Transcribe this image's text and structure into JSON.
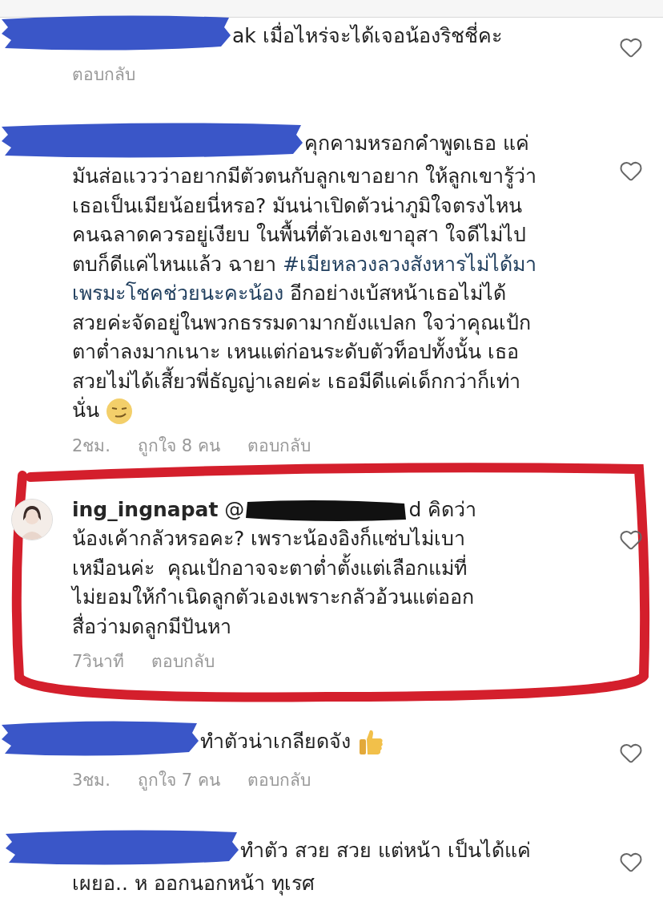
{
  "comments": [
    {
      "segments": [
        {
          "kind": "scribble"
        },
        {
          "kind": "text",
          "text": "ak เมื่อไหร่จะได้เจอน้องริชชี่คะ"
        }
      ],
      "meta": [
        "ตอบกลับ"
      ]
    },
    {
      "segments": [
        {
          "kind": "scribble"
        },
        {
          "kind": "text",
          "text": "คุกคามหรอกคำพูดเธอ แค่\nมันส่อแววว่าอยากมีตัวตนกับลูกเขาอยาก ให้ลูกเขารู้ว่า\nเธอเป็นเมียน้อยนี่หรอ? มันน่าเปิดตัวน่าภูมิใจตรงไหน\nคนฉลาดควรอยู่เงียบ ในพื้นที่ตัวเองเขาอุสา ใจดีไม่ไป\nตบก็ดีแค่ไหนแล้ว ฉายา "
        },
        {
          "kind": "hashtag",
          "text": "#เมียหลวงลวงสังหารไม่ได้มา"
        },
        {
          "kind": "line_break"
        },
        {
          "kind": "hashtag",
          "text": "เพรมะโชคช่วยนะคะน้อง"
        },
        {
          "kind": "text",
          "text": " อีกอย่างเบ้สหน้าเธอไม่ได้\nสวยค่ะจัดอยู่ในพวกธรรมดามากยังแปลก ใจว่าคุณเป้ก\nตาต่ำลงมากเนาะ เหนแต่ก่อนระดับตัวท็อปทั้งนั้น เธอ\nสวยไม่ได้เสี้ยวพี่ธัญญ่าเลยค่ะ เธอมีดีแค่เด็กกว่าก็เท่า\nนั่น "
        },
        {
          "kind": "smirk_emoji"
        }
      ],
      "meta": [
        "2ชม.",
        "ถูกใจ 8 คน",
        "ตอบกลับ"
      ]
    },
    {
      "avatar": {
        "kind": "picture"
      },
      "highlighted": true,
      "segments": [
        {
          "kind": "username",
          "text": "ing_ingnapat"
        },
        {
          "kind": "text",
          "text": " @"
        },
        {
          "kind": "blackout"
        },
        {
          "kind": "text",
          "text": "d คิดว่า\nน้องเค้ากลัวหรอคะ? เพราะน้องอิงก็แซ่บไม่เบา\nเหมือนค่ะ  คุณเป้กอาจจะตาต่ำตั้งแต่เลือกแม่ที่\nไม่ยอมให้กำเนิดลูกตัวเองเพราะกลัวอ้วนแต่ออก\nสื่อว่ามดลูกมีปันหา"
        }
      ],
      "meta": [
        "7วินาที",
        "ตอบกลับ"
      ]
    },
    {
      "segments": [
        {
          "kind": "scribble"
        },
        {
          "kind": "text",
          "text": "ทำตัวน่าเกลียดจัง "
        },
        {
          "kind": "thumbs_up_emoji"
        }
      ],
      "meta": [
        "3ชม.",
        "ถูกใจ 7 คน",
        "ตอบกลับ"
      ]
    },
    {
      "segments": [
        {
          "kind": "scribble"
        },
        {
          "kind": "text",
          "text": "ทำตัว สวย สวย แต่หน้า เป็นได้แค่\nเผยอ.. ห ออกนอกหน้า ทุเรศ"
        }
      ]
    }
  ]
}
